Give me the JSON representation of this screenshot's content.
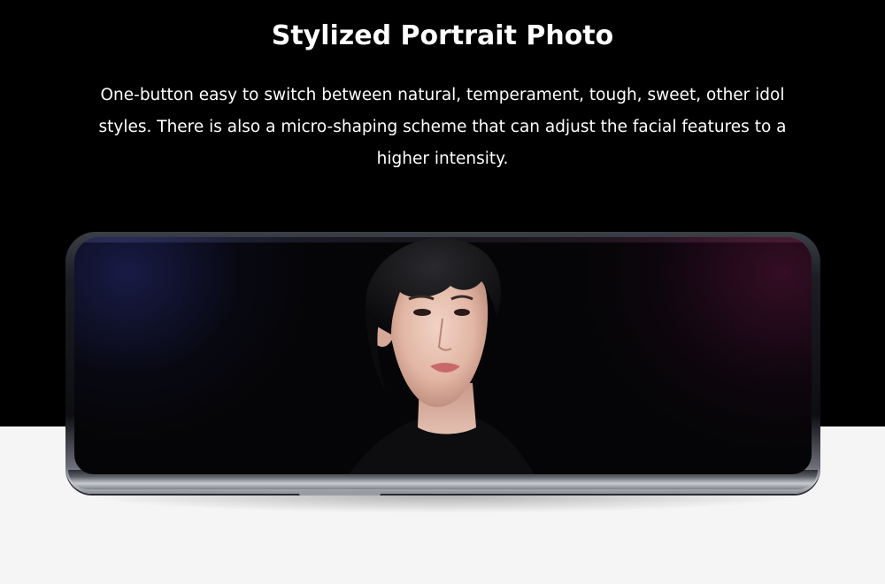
{
  "header": {
    "title": "Stylized Portrait Photo",
    "description_lines": [
      "One-button easy to switch between natural, temperament, tough, sweet, other idol",
      "styles. There is also a micro-shaping scheme that can adjust the facial features to a",
      "higher intensity."
    ]
  },
  "colors": {
    "hero_background": "#000000",
    "lower_background": "#f5f5f5",
    "text": "#ffffff"
  },
  "image": {
    "subject": "phone-with-portrait-photo"
  }
}
